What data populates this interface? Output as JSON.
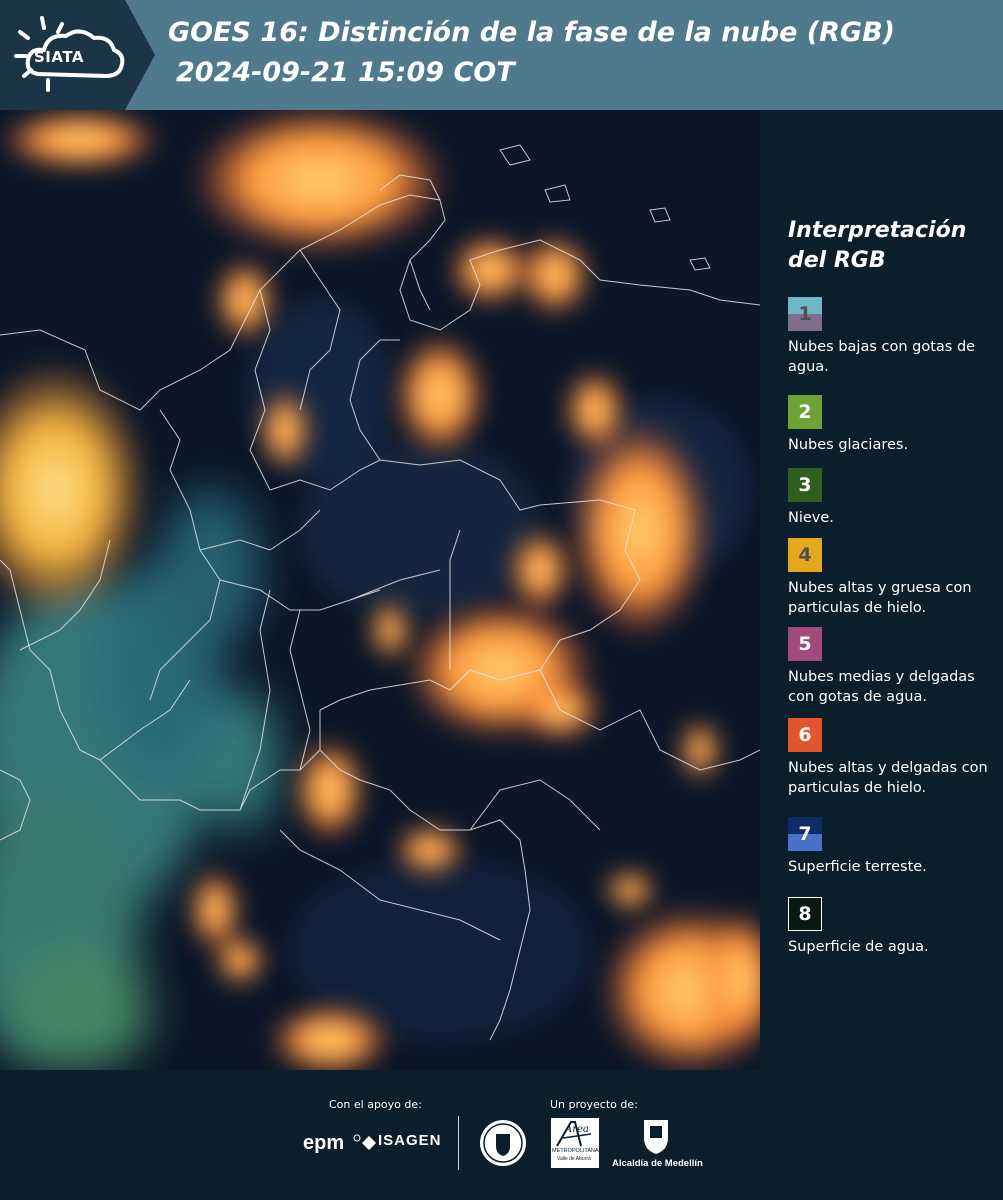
{
  "header": {
    "logo_text": "SIATA",
    "title": "GOES 16: Distinción de la fase de la nube (RGB)",
    "subtitle": "2024-09-21 15:09 COT"
  },
  "legend": {
    "title": "Interpretación del RGB",
    "items": [
      {
        "number": "1",
        "label": "Nubes bajas con gotas de agua.",
        "color_top": "#6fb8c3",
        "color_bottom": "#7f6e8e",
        "number_color": "#4d4d4d"
      },
      {
        "number": "2",
        "label": "Nubes glaciares.",
        "color_top": "#6fa232",
        "color_bottom": "#6fa232",
        "number_color": "#ffffff"
      },
      {
        "number": "3",
        "label": "Nieve.",
        "color_top": "#2f5e1e",
        "color_bottom": "#2f5e1e",
        "number_color": "#ffffff"
      },
      {
        "number": "4",
        "label": "Nubes altas y gruesa con particulas de hielo.",
        "color_top": "#e3a81c",
        "color_bottom": "#e3a81c",
        "number_color": "#4d4d4d"
      },
      {
        "number": "5",
        "label": "Nubes medias y delgadas con gotas de agua.",
        "color_top": "#a2497b",
        "color_bottom": "#a2497b",
        "number_color": "#ffffff"
      },
      {
        "number": "6",
        "label": "Nubes altas y delgadas con particulas de hielo.",
        "color_top": "#e3552b",
        "color_bottom": "#e3552b",
        "number_color": "#ffffff"
      },
      {
        "number": "7",
        "label": "Superficie terreste.",
        "color_top": "#0f2c68",
        "color_bottom": "#4b70c7",
        "number_color": "#ffffff"
      },
      {
        "number": "8",
        "label": "Superficie de agua.",
        "color_top": "#0a1a12",
        "color_bottom": "#0a1a12",
        "number_color": "#ffffff"
      }
    ]
  },
  "footer": {
    "support_label": "Con el apoyo de:",
    "project_label": "Un proyecto de:",
    "epm": "epm",
    "isagen": "ISAGEN",
    "metropolitana": "METROPOLITANA",
    "metropolitana_sub": "Valle de Aburrá",
    "area_script": "Área",
    "alcaldia": "Alcaldía de Medellín"
  }
}
